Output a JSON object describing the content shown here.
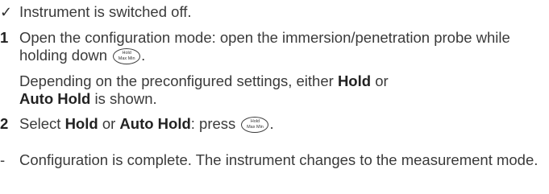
{
  "marks": {
    "check": "✓",
    "dash": "-"
  },
  "prerequisite": "Instrument is switched off.",
  "steps": [
    {
      "number": "1",
      "text_before": "Open the configuration mode: open the immersion/penetration probe while holding down",
      "text_after": ".",
      "note_before": "Depending on the preconfigured settings, either",
      "note_hold": "Hold",
      "note_middle": "or",
      "note_auto_hold": "Auto Hold",
      "note_after": "is shown."
    },
    {
      "number": "2",
      "text_before": "Select",
      "hold": "Hold",
      "text_middle": "or",
      "auto_hold": "Auto Hold",
      "text_press": ": press",
      "text_after": "."
    }
  ],
  "key": {
    "line1": "Hold",
    "line2": "Max Min"
  },
  "result": "Configuration is complete. The instrument changes to the measurement mode."
}
